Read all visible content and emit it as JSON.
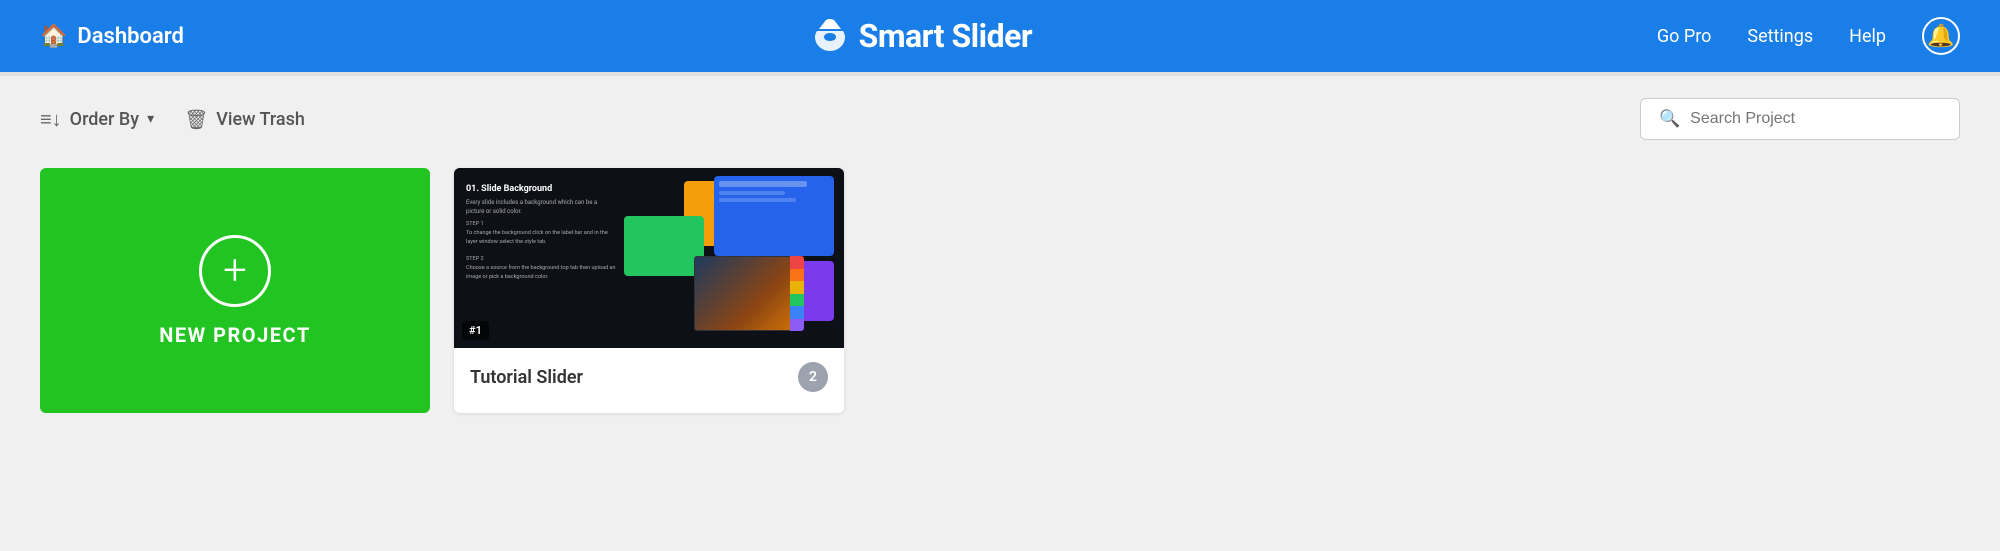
{
  "header": {
    "dashboard_label": "Dashboard",
    "logo_text": "Smart Slider",
    "go_pro_label": "Go Pro",
    "settings_label": "Settings",
    "help_label": "Help"
  },
  "toolbar": {
    "order_by_label": "Order By",
    "view_trash_label": "View Trash",
    "search_placeholder": "Search Project"
  },
  "new_project": {
    "label": "NEW PROJECT"
  },
  "sliders": [
    {
      "id": "#1",
      "title": "Tutorial Slider",
      "count": "2"
    }
  ],
  "colors": {
    "header_bg": "#1a7ee8",
    "new_project_green": "#22c422",
    "accent_blue": "#2563eb"
  }
}
